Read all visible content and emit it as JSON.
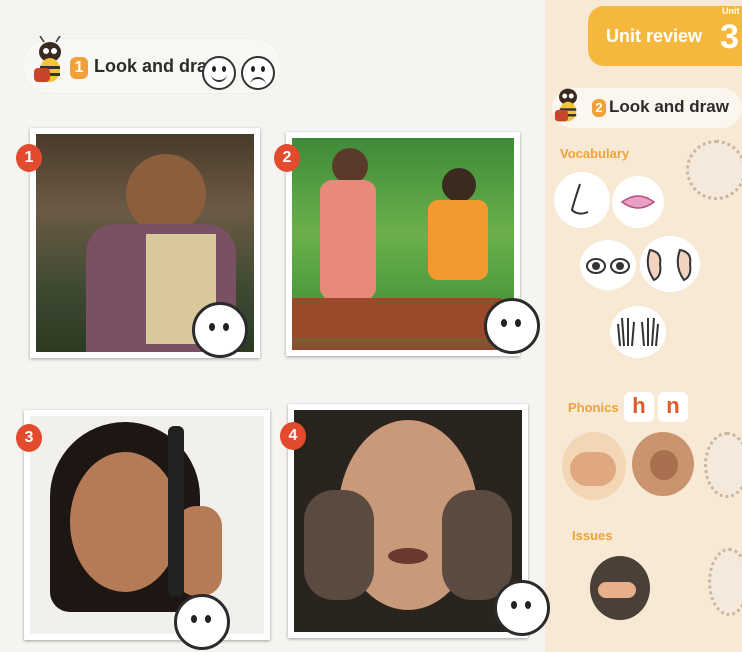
{
  "activity1": {
    "number": "1",
    "title": "Look and draw"
  },
  "photos": [
    {
      "number": "1"
    },
    {
      "number": "2"
    },
    {
      "number": "3"
    },
    {
      "number": "4"
    }
  ],
  "unit_review": {
    "label": "Unit review",
    "unit_tag": "Unit",
    "unit_number": "3"
  },
  "activity2": {
    "number": "2",
    "title": "Look and draw"
  },
  "sections": {
    "vocabulary": "Vocabulary",
    "phonics": "Phonics",
    "issues": "Issues"
  },
  "phonics_letters": [
    "h",
    "n"
  ],
  "colors": {
    "accent_orange": "#f5b73c",
    "number_red": "#e44a2e",
    "letter_red": "#e05a2a"
  }
}
